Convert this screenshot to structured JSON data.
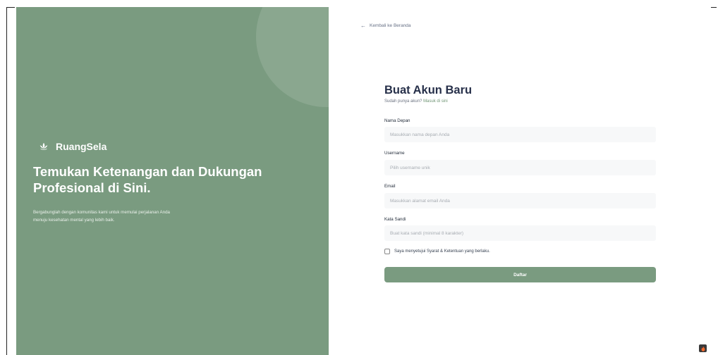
{
  "hero": {
    "brand_name": "RuangSela",
    "title": "Temukan Ketenangan dan Dukungan Profesional di Sini.",
    "description": "Bergabunglah dengan komunitas kami untuk memulai perjalanan Anda menuju kesehatan mental yang lebih baik."
  },
  "back_link": {
    "label": "Kembali ke Beranda",
    "icon": "arrow-left-icon"
  },
  "form": {
    "title": "Buat Akun Baru",
    "subtitle_prefix": "Sudah punya akun?",
    "subtitle_link": "Masuk di sini",
    "fields": [
      {
        "label": "Nama Depan",
        "placeholder": "Masukkan nama depan Anda",
        "value": ""
      },
      {
        "label": "Username",
        "placeholder": "Pilih username unik",
        "value": ""
      },
      {
        "label": "Email",
        "placeholder": "Masukkan alamat email Anda",
        "value": ""
      },
      {
        "label": "Kata Sandi",
        "placeholder": "Buat kata sandi (minimal 8 karakter)",
        "value": ""
      }
    ],
    "terms_label": "Saya menyetujui Syarat & Ketentuan yang berlaku.",
    "terms_checked": false,
    "submit_label": "Daftar"
  },
  "colors": {
    "accent": "#7a9b80",
    "title": "#27304a",
    "input_bg": "#f7f8f9"
  }
}
